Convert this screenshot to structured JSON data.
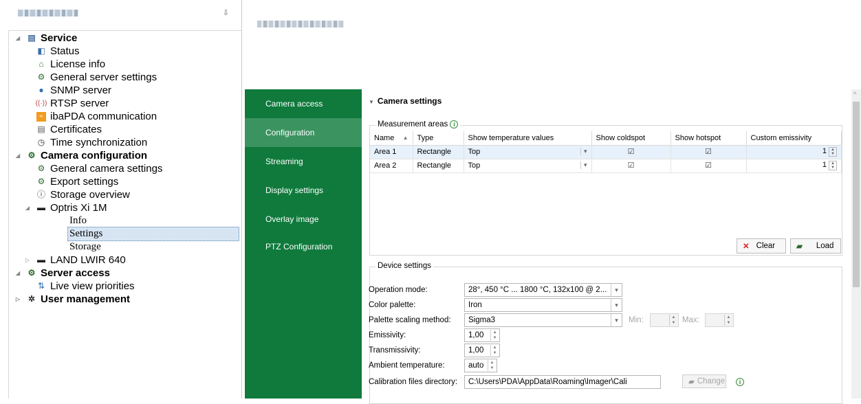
{
  "tree": {
    "items": [
      {
        "label": "Service",
        "icon": "server-icon",
        "level": 0,
        "bold": true,
        "expander": "◢"
      },
      {
        "label": "Status",
        "icon": "status-icon",
        "level": 1
      },
      {
        "label": "License info",
        "icon": "license-icon",
        "level": 1
      },
      {
        "label": "General server settings",
        "icon": "gears-icon",
        "level": 1
      },
      {
        "label": "SNMP server",
        "icon": "snmp-icon",
        "level": 1
      },
      {
        "label": "RTSP server",
        "icon": "rtsp-icon",
        "level": 1
      },
      {
        "label": "ibaPDA communication",
        "icon": "ibapda-icon",
        "level": 1
      },
      {
        "label": "Certificates",
        "icon": "certificate-icon",
        "level": 1
      },
      {
        "label": "Time synchronization",
        "icon": "clock-icon",
        "level": 1
      },
      {
        "label": "Camera configuration",
        "icon": "gears-icon",
        "level": 0,
        "bold": true,
        "expander": "◢"
      },
      {
        "label": "General camera settings",
        "icon": "gears-icon",
        "level": 1
      },
      {
        "label": "Export settings",
        "icon": "gears-icon",
        "level": 1
      },
      {
        "label": "Storage overview",
        "icon": "info-icon",
        "level": 1
      },
      {
        "label": "Optris Xi 1M",
        "icon": "camera-icon",
        "level": 1,
        "expander": "◢"
      },
      {
        "label": "Info",
        "level": 2
      },
      {
        "label": "Settings",
        "level": 2,
        "selected": true
      },
      {
        "label": "Storage",
        "level": 2
      },
      {
        "label": "LAND LWIR 640",
        "icon": "camera-icon",
        "level": 1,
        "expander": "▷"
      },
      {
        "label": "Server access",
        "icon": "gears-icon",
        "level": 0,
        "bold": true,
        "expander": "◢"
      },
      {
        "label": "Live view priorities",
        "icon": "priorities-icon",
        "level": 1
      },
      {
        "label": "User management",
        "icon": "users-gear-icon",
        "level": 0,
        "bold": true,
        "expander": "▷"
      }
    ]
  },
  "nav": {
    "items": [
      "Camera access",
      "Configuration",
      "Streaming",
      "Display settings",
      "Overlay image",
      "PTZ Configuration"
    ],
    "active": "Configuration"
  },
  "camera_settings": {
    "title": "Camera settings",
    "measurement_areas": {
      "label": "Measurement areas",
      "columns": [
        "Name",
        "Type",
        "Show temperature values",
        "Show coldspot",
        "Show hotspot",
        "Custom emissivity"
      ],
      "rows": [
        {
          "name": "Area 1",
          "type": "Rectangle",
          "temp": "Top",
          "coldspot": true,
          "hotspot": true,
          "emissivity": "1"
        },
        {
          "name": "Area 2",
          "type": "Rectangle",
          "temp": "Top",
          "coldspot": true,
          "hotspot": true,
          "emissivity": "1"
        }
      ],
      "clear_label": "Clear",
      "load_label": "Load"
    },
    "device": {
      "label": "Device settings",
      "operation_mode_label": "Operation mode:",
      "operation_mode_value": "28°, 450 °C ... 1800 °C, 132x100 @ 2...",
      "color_palette_label": "Color palette:",
      "color_palette_value": "Iron",
      "scaling_label": "Palette scaling method:",
      "scaling_value": "Sigma3",
      "min_label": "Min:",
      "max_label": "Max:",
      "emissivity_label": "Emissivity:",
      "emissivity_value": "1,00",
      "transmissivity_label": "Transmissivity:",
      "transmissivity_value": "1,00",
      "ambient_label": "Ambient temperature:",
      "ambient_value": "auto",
      "calib_label": "Calibration files directory:",
      "calib_value": "C:\\Users\\PDA\\AppData\\Roaming\\Imager\\Cali",
      "change_label": "Change"
    }
  },
  "colors": {
    "nav_green": "#0f7a3c",
    "nav_active": "#3b9460",
    "selection": "#e7f1fb"
  }
}
